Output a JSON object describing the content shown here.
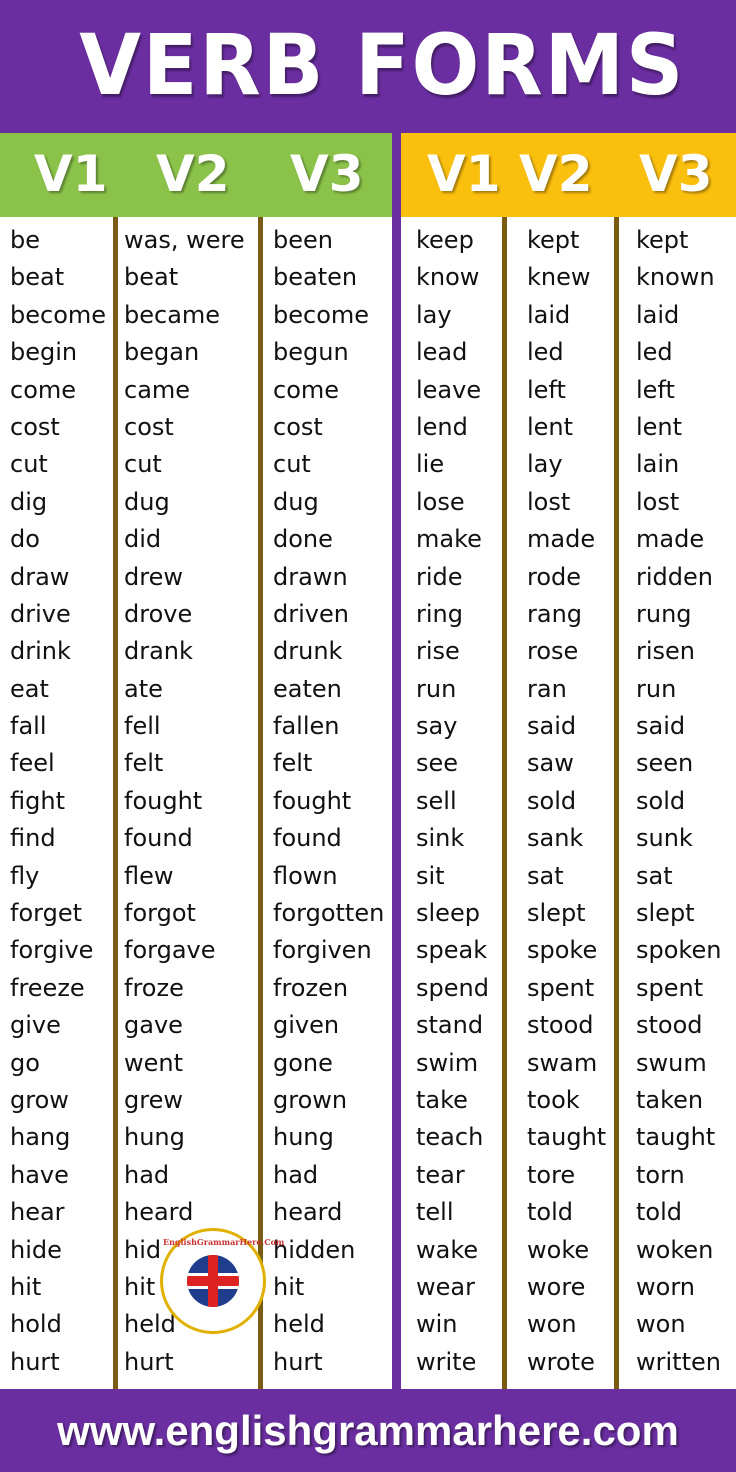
{
  "title": "VERB FORMS",
  "headers": {
    "left": [
      "V1",
      "V2",
      "V3"
    ],
    "right": [
      "V1",
      "V2",
      "V3"
    ]
  },
  "colors": {
    "background": "#6a2ea0",
    "left_header": "#8bc34a",
    "right_header": "#fbbf0e",
    "separator": "#7a5c10"
  },
  "left_table": {
    "v1": [
      "be",
      "beat",
      "become",
      "begin",
      "come",
      "cost",
      "cut",
      "dig",
      "do",
      "draw",
      "drive",
      "drink",
      "eat",
      "fall",
      "feel",
      "fight",
      "find",
      "fly",
      "forget",
      "forgive",
      "freeze",
      "give",
      "go",
      "grow",
      "hang",
      "have",
      "hear",
      "hide",
      "hit",
      "hold",
      "hurt"
    ],
    "v2": [
      "was, were",
      "beat",
      "became",
      "began",
      "came",
      "cost",
      "cut",
      "dug",
      "did",
      "drew",
      "drove",
      "drank",
      "ate",
      "fell",
      "felt",
      "fought",
      "found",
      "flew",
      "forgot",
      "forgave",
      "froze",
      "gave",
      "went",
      "grew",
      "hung",
      "had",
      "heard",
      "hid",
      "hit",
      "held",
      "hurt"
    ],
    "v3": [
      "been",
      "beaten",
      "become",
      "begun",
      "come",
      "cost",
      "cut",
      "dug",
      "done",
      "drawn",
      "driven",
      "drunk",
      "eaten",
      "fallen",
      "felt",
      "fought",
      "found",
      "flown",
      "forgotten",
      "forgiven",
      "frozen",
      "given",
      "gone",
      "grown",
      "hung",
      "had",
      "heard",
      "hidden",
      "hit",
      "held",
      "hurt"
    ]
  },
  "right_table": {
    "v1": [
      "keep",
      "know",
      "lay",
      "lead",
      "leave",
      "lend",
      "lie",
      "lose",
      "make",
      "ride",
      "ring",
      "rise",
      "run",
      "say",
      "see",
      "sell",
      "sink",
      "sit",
      "sleep",
      "speak",
      "spend",
      "stand",
      "swim",
      "take",
      "teach",
      "tear",
      "tell",
      "wake",
      "wear",
      "win",
      "write"
    ],
    "v2": [
      "kept",
      "knew",
      "laid",
      "led",
      "left",
      "lent",
      "lay",
      "lost",
      "made",
      "rode",
      "rang",
      "rose",
      "ran",
      "said",
      "saw",
      "sold",
      "sank",
      "sat",
      "slept",
      "spoke",
      "spent",
      "stood",
      "swam",
      "took",
      "taught",
      "tore",
      "told",
      "woke",
      "wore",
      "won",
      "wrote"
    ],
    "v3": [
      "kept",
      "known",
      "laid",
      "led",
      "left",
      "lent",
      "lain",
      "lost",
      "made",
      "ridden",
      "rung",
      "risen",
      "run",
      "said",
      "seen",
      "sold",
      "sunk",
      "sat",
      "slept",
      "spoken",
      "spent",
      "stood",
      "swum",
      "taken",
      "taught",
      "torn",
      "told",
      "woken",
      "worn",
      "won",
      "written"
    ]
  },
  "logo": {
    "text": "EnglishGrammarHere.Com"
  },
  "footer": "www.englishgrammarhere.com"
}
